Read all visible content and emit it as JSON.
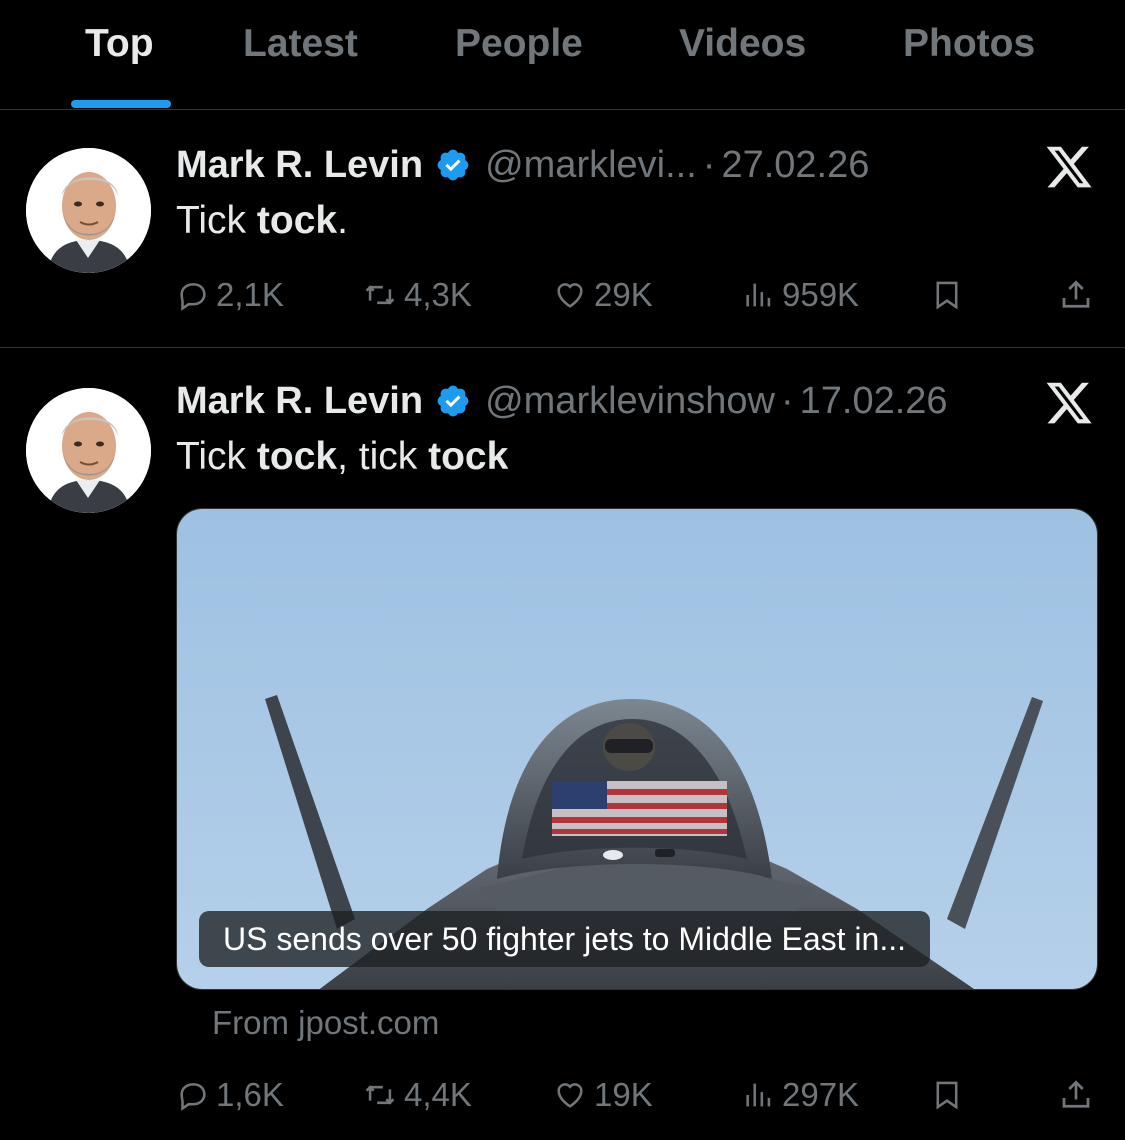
{
  "tabs": [
    {
      "label": "Top",
      "active": true
    },
    {
      "label": "Latest",
      "active": false
    },
    {
      "label": "People",
      "active": false
    },
    {
      "label": "Videos",
      "active": false
    },
    {
      "label": "Photos",
      "active": false
    }
  ],
  "colors": {
    "accent": "#1d9bf0",
    "muted": "#71767b",
    "text": "#e7e9ea",
    "background": "#000000",
    "divider": "#2f3336"
  },
  "tweets": [
    {
      "author": "Mark R. Levin",
      "verified_icon": "verified-badge-icon",
      "handle": "@marklevi...",
      "separator": "·",
      "date": "27.02.26",
      "text": {
        "p1": "Tick ",
        "b1": "tock",
        "p2": "."
      },
      "stats": {
        "replies": "2,1K",
        "reposts": "4,3K",
        "likes": "29K",
        "views": "959K"
      }
    },
    {
      "author": "Mark R. Levin",
      "verified_icon": "verified-badge-icon",
      "handle": "@marklevinshow",
      "separator": "·",
      "date": "17.02.26",
      "text": {
        "p1": "Tick ",
        "b1": "tock",
        "p2": ", tick ",
        "b2": "tock"
      },
      "media": {
        "caption": "US sends over 50 fighter jets to Middle East in...",
        "source": "From jpost.com"
      },
      "stats": {
        "replies": "1,6K",
        "reposts": "4,4K",
        "likes": "19K",
        "views": "297K"
      }
    }
  ]
}
